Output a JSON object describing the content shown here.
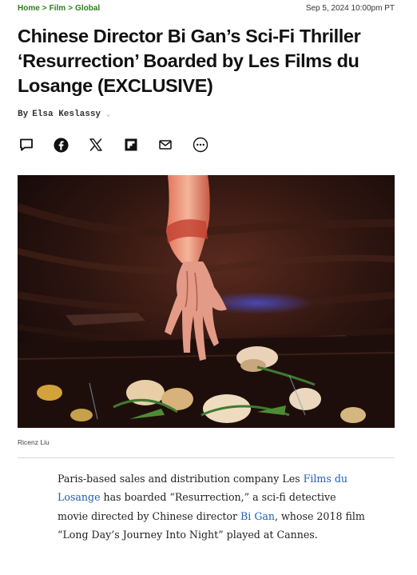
{
  "breadcrumb": {
    "items": [
      "Home",
      "Film",
      "Global"
    ],
    "separator": ">"
  },
  "dateline": "Sep 5, 2024 10:00pm PT",
  "headline": "Chinese Director Bi Gan’s Sci-Fi Thriller ‘Resurrection’ Boarded by Les Films du Losange (EXCLUSIVE)",
  "byline": {
    "prefix": "By",
    "author": "Elsa Keslassy"
  },
  "share_icons": [
    "comment-icon",
    "facebook-icon",
    "x-icon",
    "flipboard-icon",
    "email-icon",
    "more-icon"
  ],
  "photo_credit": "Ricenz Liu",
  "article": {
    "p1": {
      "t1": "Paris-based sales and distribution company Les ",
      "link1": "Films du Losange",
      "t2": " has boarded “Resurrection,” a sci-fi detective movie directed by Chinese director ",
      "link2": "Bi Gan",
      "t3": ", whose 2018 film “Long Day’s Journey Into Night” played at Cannes."
    }
  },
  "colors": {
    "breadcrumb": "#2e7d1e",
    "link": "#1f5fb5",
    "text": "#111111"
  }
}
